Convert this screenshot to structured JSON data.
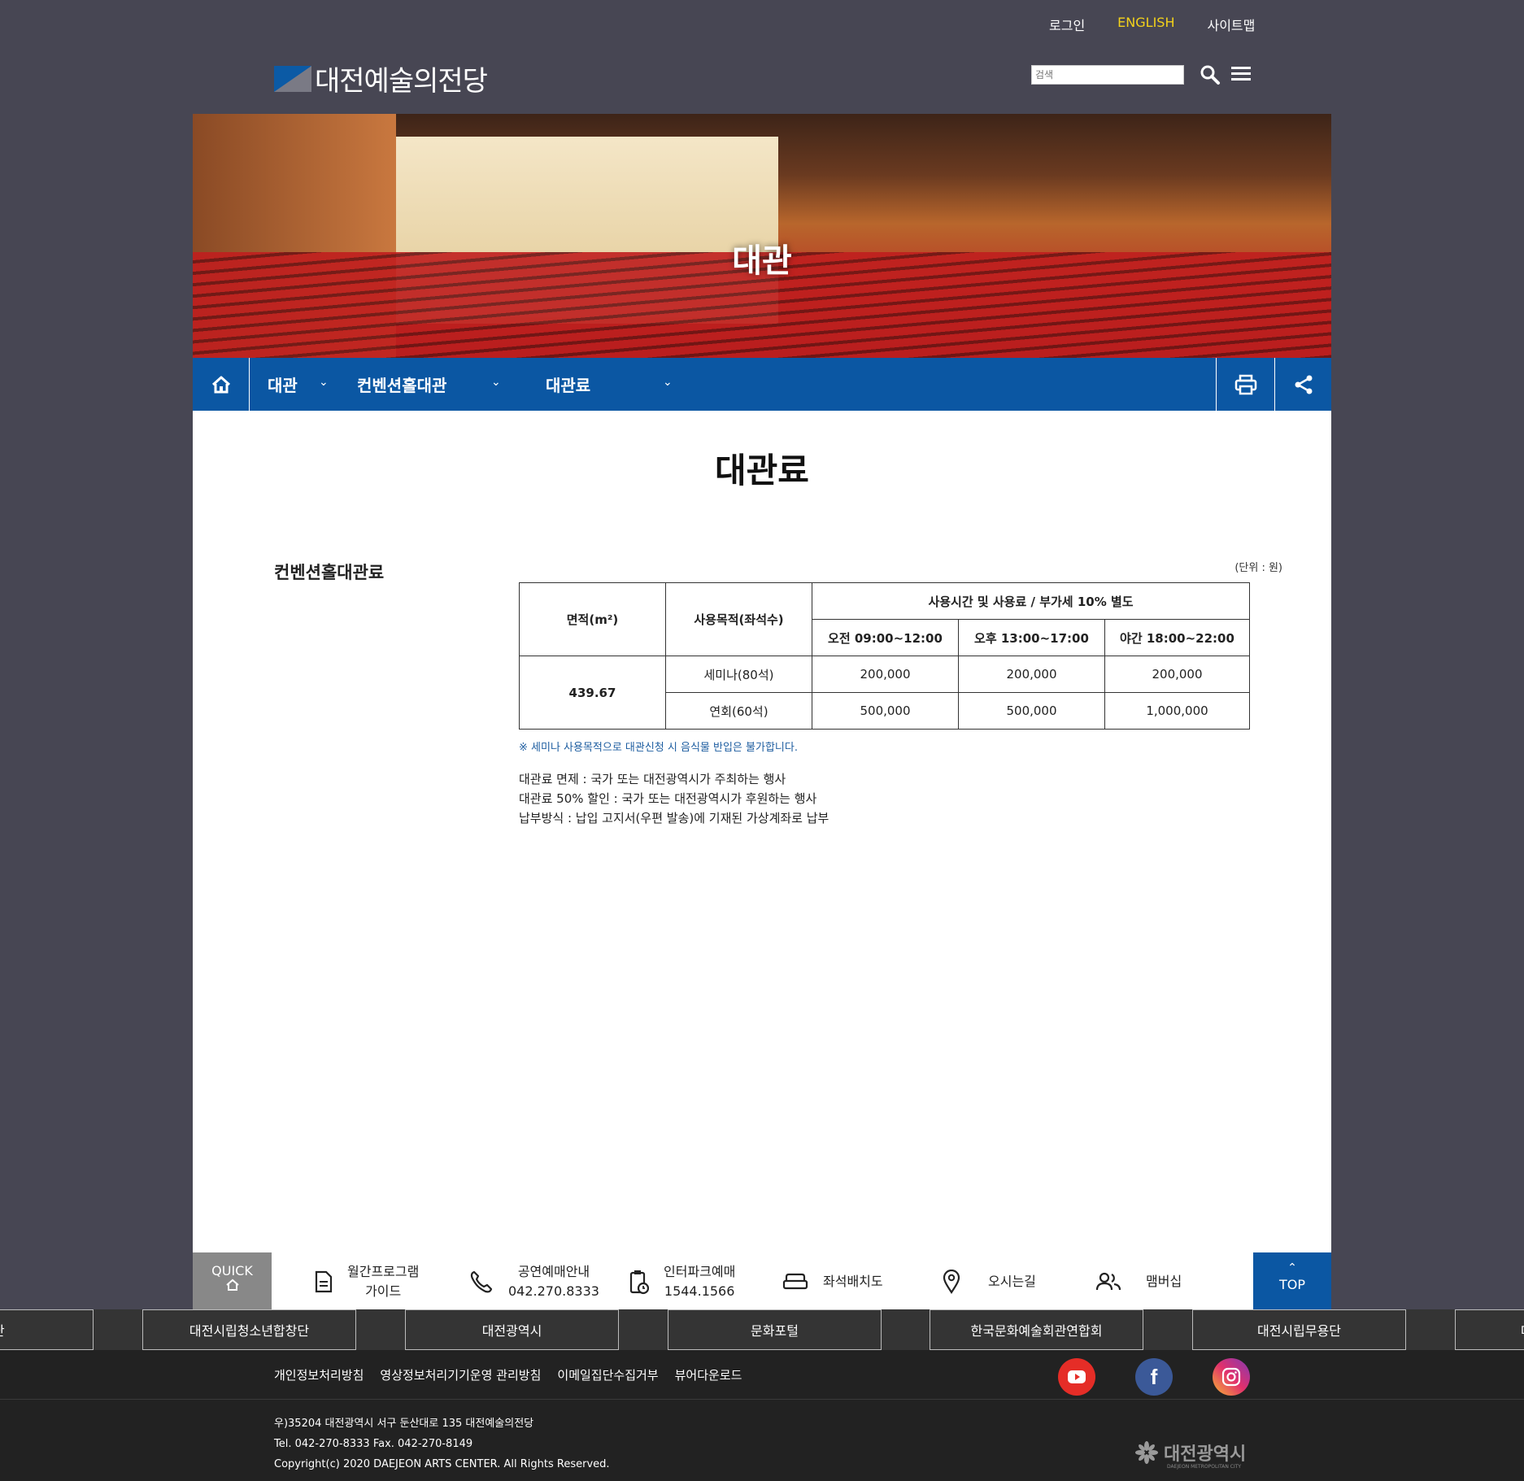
{
  "util": {
    "login": "로그인",
    "english": "ENGLISH",
    "sitemap": "사이트맵"
  },
  "logo": {
    "text": "대전예술의전당"
  },
  "search": {
    "placeholder": "검색"
  },
  "hero": {
    "title": "대관"
  },
  "nav": {
    "items": [
      {
        "label": "대관"
      },
      {
        "label": "컨벤션홀대관"
      },
      {
        "label": "대관료"
      }
    ]
  },
  "page": {
    "title": "대관료"
  },
  "section": {
    "title": "컨벤션홀대관료",
    "unit": "(단위 : 원)"
  },
  "table": {
    "headers": {
      "area": "면적(m²)",
      "purpose": "사용목적(좌석수)",
      "time_group": "사용시간 및 사용료 / 부가세 10% 별도",
      "times": [
        "오전 09:00~12:00",
        "오후 13:00~17:00",
        "야간 18:00~22:00"
      ]
    },
    "area": "439.67",
    "rows": [
      {
        "purpose": "세미나(80석)",
        "values": [
          "200,000",
          "200,000",
          "200,000"
        ]
      },
      {
        "purpose": "연회(60석)",
        "values": [
          "500,000",
          "500,000",
          "1,000,000"
        ]
      }
    ]
  },
  "note": "※ 세미나 사용목적으로 대관신청 시 음식물 반입은 불가합니다.",
  "info": [
    "대관료 면제 : 국가 또는 대전광역시가 주최하는 행사",
    "대관료 50% 할인 : 국가 또는 대전광역시가 후원하는 행사",
    "납부방식 : 납입 고지서(우편 발송)에 기재된 가상계좌로 납부"
  ],
  "quick": {
    "label": "QUICK",
    "items": [
      {
        "line1": "월간프로그램",
        "line2": "가이드",
        "icon": "document-icon"
      },
      {
        "line1": "공연예매안내",
        "line2": "042.270.8333",
        "icon": "phone-icon"
      },
      {
        "line1": "인터파크예매",
        "line2": "1544.1566",
        "icon": "clipboard-clock-icon"
      },
      {
        "line1": "좌석배치도",
        "line2": "",
        "icon": "sofa-icon"
      },
      {
        "line1": "오시는길",
        "line2": "",
        "icon": "map-pin-icon"
      },
      {
        "line1": "맴버십",
        "line2": "",
        "icon": "users-icon"
      }
    ],
    "top": "TOP"
  },
  "strip": [
    "향악단",
    "대전시립청소년합창단",
    "대전광역시",
    "문화포털",
    "한국문화예술회관연합회",
    "대전시립무용단",
    "대"
  ],
  "footer": {
    "links": [
      "개인정보처리방침",
      "영상정보처리기기운영 관리방침",
      "이메일집단수집거부",
      "뷰어다운로드"
    ],
    "address": "우)35204 대전광역시 서구 둔산대로 135 대전예술의전당",
    "tel": "Tel. 042-270-8333 Fax. 042-270-8149",
    "copyright": "Copyright(c) 2020 DAEJEON ARTS CENTER. All Rights Reserved.",
    "city_name": "대전광역시",
    "city_sub": "DAEJEON METROPOLITAN CITY"
  },
  "colors": {
    "navy": "#0b57a3",
    "page_bg": "#474653",
    "accent_yellow": "#f3d21b",
    "youtube": "#e52d27",
    "facebook": "#3b5998"
  }
}
